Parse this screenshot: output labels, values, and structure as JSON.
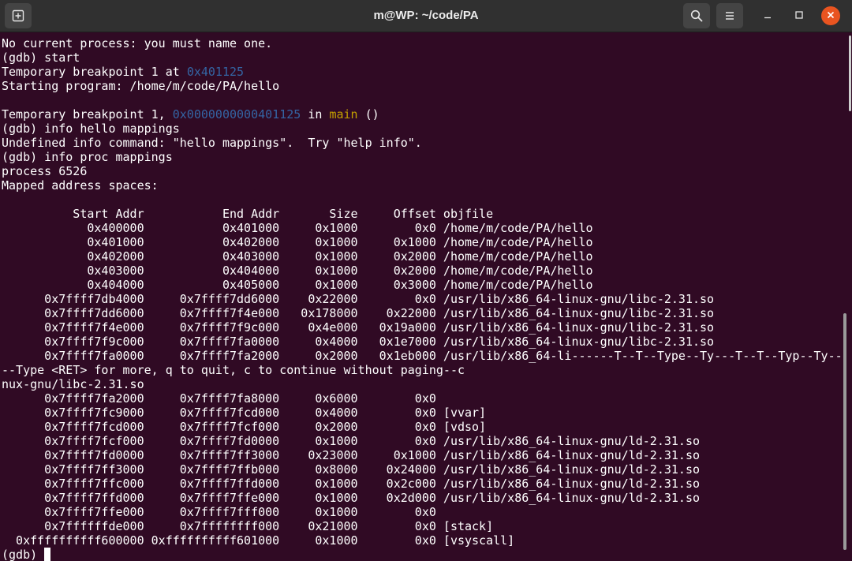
{
  "window": {
    "title": "m@WP: ~/code/PA",
    "accent_close_color": "#e95420",
    "background_color": "#300a24"
  },
  "titlebar": {
    "new_tab_icon": "new-tab-icon",
    "search_icon": "search-icon",
    "menu_icon": "hamburger-menu-icon",
    "minimize_icon": "minimize-icon",
    "maximize_icon": "maximize-icon",
    "close_icon": "close-icon"
  },
  "colors": {
    "address": "#3465a4",
    "function_name": "#c4a000",
    "text": "#ffffff"
  },
  "terminal": {
    "l1": "No current process: you must name one.",
    "l2": "(gdb) start",
    "l3_a": "Temporary breakpoint 1 at ",
    "l3_addr": "0x401125",
    "l4": "Starting program: /home/m/code/PA/hello",
    "l5": "",
    "l6_a": "Temporary breakpoint 1, ",
    "l6_addr": "0x0000000000401125",
    "l6_b": " in ",
    "l6_func": "main",
    "l6_c": " ()",
    "l7": "(gdb) info hello mappings",
    "l8": "Undefined info command: \"hello mappings\".  Try \"help info\".",
    "l9": "(gdb) info proc mappings",
    "l10": "process 6526",
    "l11": "Mapped address spaces:",
    "l12": "",
    "l13": "          Start Addr           End Addr       Size     Offset objfile",
    "l14": "            0x400000           0x401000     0x1000        0x0 /home/m/code/PA/hello",
    "l15": "            0x401000           0x402000     0x1000     0x1000 /home/m/code/PA/hello",
    "l16": "            0x402000           0x403000     0x1000     0x2000 /home/m/code/PA/hello",
    "l17": "            0x403000           0x404000     0x1000     0x2000 /home/m/code/PA/hello",
    "l18": "            0x404000           0x405000     0x1000     0x3000 /home/m/code/PA/hello",
    "l19": "      0x7ffff7db4000     0x7ffff7dd6000    0x22000        0x0 /usr/lib/x86_64-linux-gnu/libc-2.31.so",
    "l20": "      0x7ffff7dd6000     0x7ffff7f4e000   0x178000    0x22000 /usr/lib/x86_64-linux-gnu/libc-2.31.so",
    "l21": "      0x7ffff7f4e000     0x7ffff7f9c000    0x4e000   0x19a000 /usr/lib/x86_64-linux-gnu/libc-2.31.so",
    "l22": "      0x7ffff7f9c000     0x7ffff7fa0000     0x4000   0x1e7000 /usr/lib/x86_64-linux-gnu/libc-2.31.so",
    "l23": "      0x7ffff7fa0000     0x7ffff7fa2000     0x2000   0x1eb000 /usr/lib/x86_64-li------T--T--Type--Ty---T--T--Typ--Ty--",
    "l24": "--Type <RET> for more, q to quit, c to continue without paging--c",
    "l25": "nux-gnu/libc-2.31.so",
    "l26": "      0x7ffff7fa2000     0x7ffff7fa8000     0x6000        0x0",
    "l27": "      0x7ffff7fc9000     0x7ffff7fcd000     0x4000        0x0 [vvar]",
    "l28": "      0x7ffff7fcd000     0x7ffff7fcf000     0x2000        0x0 [vdso]",
    "l29": "      0x7ffff7fcf000     0x7ffff7fd0000     0x1000        0x0 /usr/lib/x86_64-linux-gnu/ld-2.31.so",
    "l30": "      0x7ffff7fd0000     0x7ffff7ff3000    0x23000     0x1000 /usr/lib/x86_64-linux-gnu/ld-2.31.so",
    "l31": "      0x7ffff7ff3000     0x7ffff7ffb000     0x8000    0x24000 /usr/lib/x86_64-linux-gnu/ld-2.31.so",
    "l32": "      0x7ffff7ffc000     0x7ffff7ffd000     0x1000    0x2c000 /usr/lib/x86_64-linux-gnu/ld-2.31.so",
    "l33": "      0x7ffff7ffd000     0x7ffff7ffe000     0x1000    0x2d000 /usr/lib/x86_64-linux-gnu/ld-2.31.so",
    "l34": "      0x7ffff7ffe000     0x7ffff7fff000     0x1000        0x0",
    "l35": "      0x7ffffffde000     0x7ffffffff000    0x21000        0x0 [stack]",
    "l36": "  0xffffffffff600000 0xffffffffff601000     0x1000        0x0 [vsyscall]",
    "l37": "(gdb) "
  }
}
